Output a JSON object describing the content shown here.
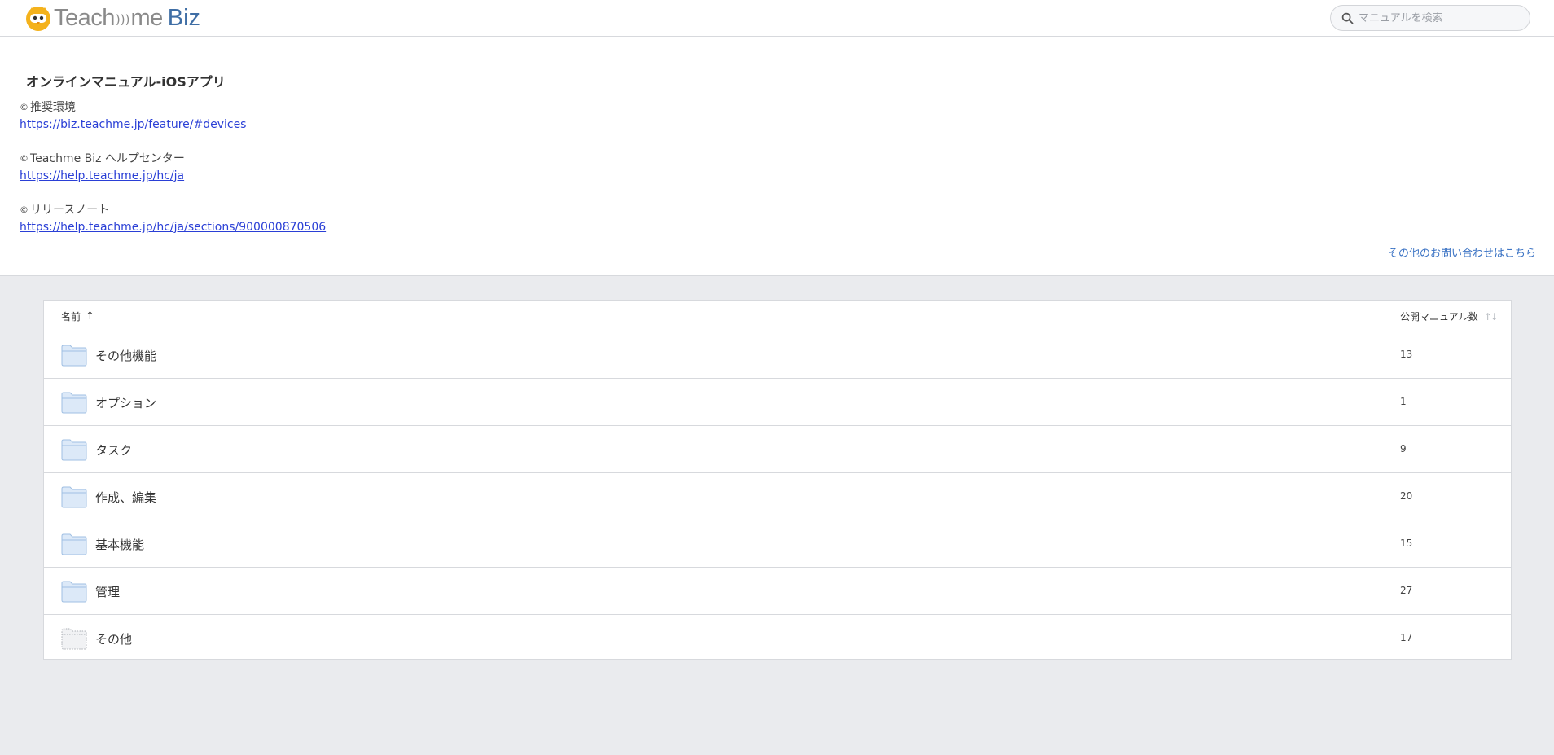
{
  "header": {
    "logo_teach": "Teach",
    "logo_me": "me",
    "logo_biz": "Biz",
    "search_placeholder": "マニュアルを検索"
  },
  "description": {
    "title": "オンラインマニュアル-iOSアプリ",
    "sections": [
      {
        "mark": "©",
        "heading": "推奨環境",
        "link": "https://biz.teachme.jp/feature/#devices"
      },
      {
        "mark": "©",
        "heading": "Teachme Biz ヘルプセンター",
        "link": "https://help.teachme.jp/hc/ja"
      },
      {
        "mark": "©",
        "heading": "リリースノート",
        "link": "https://help.teachme.jp/hc/ja/sections/900000870506"
      }
    ],
    "contact_link": "その他のお問い合わせはこちら"
  },
  "table": {
    "col_name": "名前",
    "col_name_sort": "↑",
    "col_count": "公開マニュアル数",
    "col_count_sort": "↑↓",
    "rows": [
      {
        "name": "その他機能",
        "count": "13",
        "folder": "folder-icon"
      },
      {
        "name": "オプション",
        "count": "1",
        "folder": "folder-icon"
      },
      {
        "name": "タスク",
        "count": "9",
        "folder": "folder-icon"
      },
      {
        "name": "作成、編集",
        "count": "20",
        "folder": "folder-icon"
      },
      {
        "name": "基本機能",
        "count": "15",
        "folder": "folder-icon"
      },
      {
        "name": "管理",
        "count": "27",
        "folder": "folder-icon"
      },
      {
        "name": "その他",
        "count": "17",
        "folder": "folder-dotted-icon"
      }
    ]
  },
  "colors": {
    "page_bg": "#eaebee",
    "link": "#2a3fd6",
    "accent_link": "#3b73c4",
    "logo_biz": "#3f6ea5",
    "folder_fill": "#dce9f8",
    "folder_stroke": "#9fbfe3"
  }
}
